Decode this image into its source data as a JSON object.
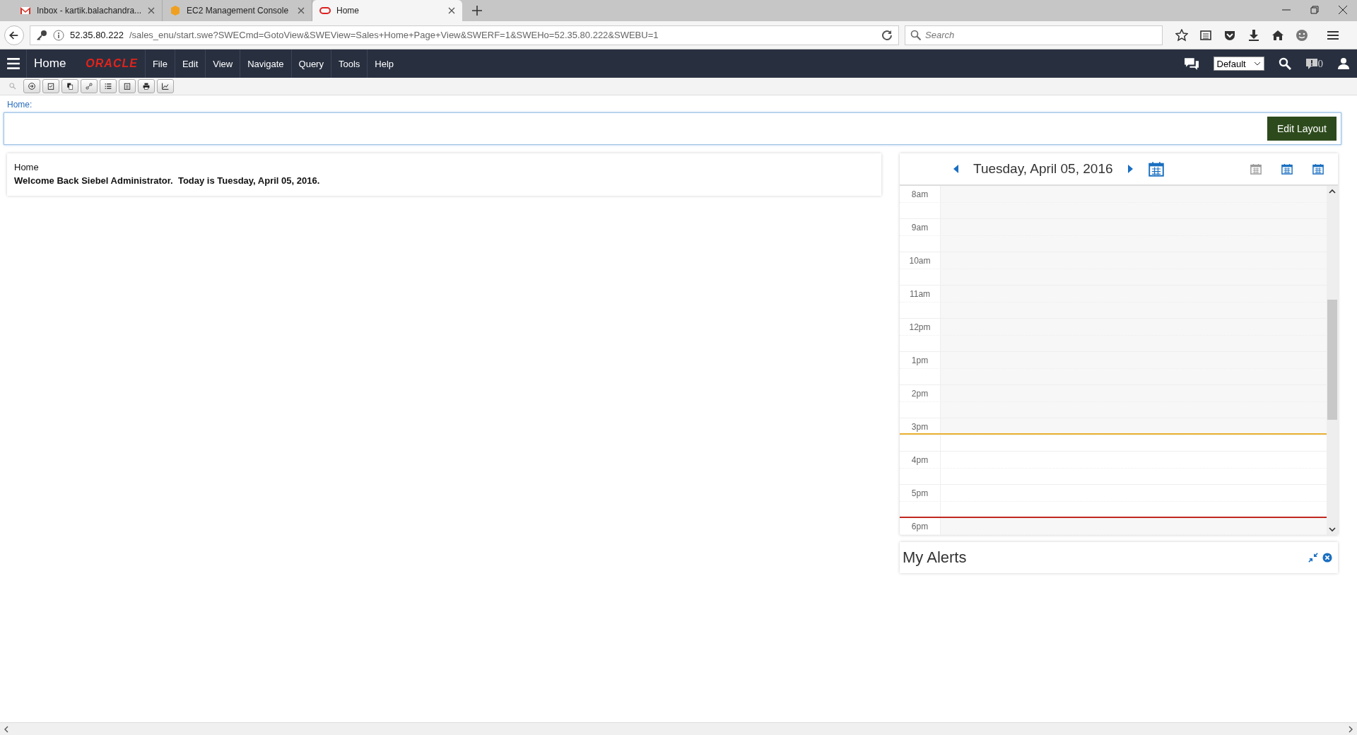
{
  "browser": {
    "tabs": [
      {
        "label": "Inbox - kartik.balachandra...",
        "selected": false
      },
      {
        "label": "EC2 Management Console",
        "selected": false
      },
      {
        "label": "Home",
        "selected": true
      }
    ],
    "url_host": "52.35.80.222",
    "url_path": "/sales_enu/start.swe?SWECmd=GotoView&SWEView=Sales+Home+Page+View&SWERF=1&SWEHo=52.35.80.222&SWEBU=1",
    "search_placeholder": "Search"
  },
  "app_header": {
    "title": "Home",
    "logo": "ORACLE",
    "menu": [
      "File",
      "Edit",
      "View",
      "Navigate",
      "Query",
      "Tools",
      "Help"
    ],
    "layout_select": "Default",
    "alerts_count": "0"
  },
  "toolbar": [
    {
      "disabled": true
    },
    {
      "disabled": false
    },
    {
      "disabled": false
    },
    {
      "disabled": false
    },
    {
      "disabled": false
    },
    {
      "disabled": false
    },
    {
      "disabled": false
    },
    {
      "disabled": false
    },
    {
      "disabled": false
    }
  ],
  "breadcrumb": "Home:",
  "edit_layout_button": "Edit Layout",
  "welcome": {
    "title": "Home",
    "message": "Welcome Back Siebel Administrator.  Today is Tuesday, April 05, 2016."
  },
  "calendar": {
    "date": "Tuesday, April 05, 2016",
    "hours": [
      "8am",
      "9am",
      "10am",
      "11am",
      "12pm",
      "1pm",
      "2pm",
      "3pm",
      "4pm",
      "5pm",
      "6pm"
    ]
  },
  "alerts": {
    "title": "My Alerts"
  }
}
